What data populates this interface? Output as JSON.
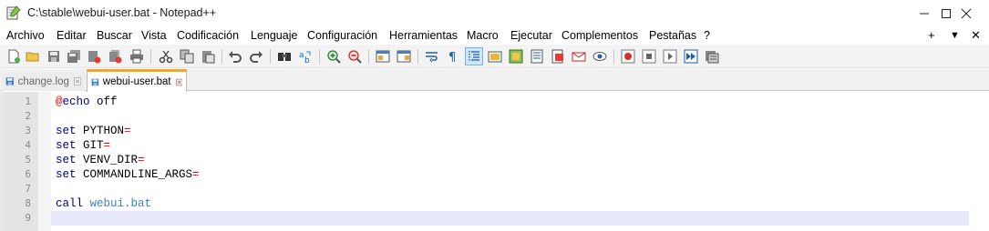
{
  "window": {
    "title": "C:\\stable\\webui-user.bat - Notepad++",
    "minimize_icon": "minimize-icon",
    "maximize_icon": "maximize-icon",
    "close_icon": "close-icon"
  },
  "menu": {
    "items": [
      "Archivo",
      "Editar",
      "Buscar",
      "Vista",
      "Codificación",
      "Lenguaje",
      "Configuración",
      "Herramientas",
      "Macro",
      "Ejecutar",
      "Complementos",
      "Pestañas",
      "?"
    ],
    "right": [
      "+",
      "▼",
      "✕"
    ]
  },
  "toolbar": {
    "icons": [
      "new-file-icon",
      "open-file-icon",
      "save-icon",
      "save-all-icon",
      "close-icon",
      "close-all-icon",
      "print-icon",
      "cut-icon",
      "copy-icon",
      "paste-icon",
      "undo-icon",
      "redo-icon",
      "find-icon",
      "replace-icon",
      "zoom-in-icon",
      "zoom-out-icon",
      "sync-vertical-icon",
      "sync-horizontal-icon",
      "word-wrap-icon",
      "show-all-chars-icon",
      "indent-guide-icon",
      "udl-icon",
      "doc-map-icon",
      "function-list-icon",
      "folder-workspace-icon",
      "doc-list-icon",
      "monitoring-icon",
      "record-macro-icon",
      "stop-recording-icon",
      "playback-macro-icon",
      "run-macro-multiple-icon",
      "save-macro-icon"
    ]
  },
  "tabs": [
    {
      "label": "change.log",
      "active": false
    },
    {
      "label": "webui-user.bat",
      "active": true
    }
  ],
  "editor": {
    "lines": [
      {
        "num": "1",
        "tokens": [
          {
            "t": "@",
            "c": "at"
          },
          {
            "t": "echo",
            "c": "kw-echo"
          },
          {
            "t": " off",
            "c": "txt"
          }
        ]
      },
      {
        "num": "2",
        "tokens": []
      },
      {
        "num": "3",
        "tokens": [
          {
            "t": "set",
            "c": "kw"
          },
          {
            "t": " PYTHON",
            "c": "txt"
          },
          {
            "t": "=",
            "c": "op"
          }
        ]
      },
      {
        "num": "4",
        "tokens": [
          {
            "t": "set",
            "c": "kw"
          },
          {
            "t": " GIT",
            "c": "txt"
          },
          {
            "t": "=",
            "c": "op"
          }
        ]
      },
      {
        "num": "5",
        "tokens": [
          {
            "t": "set",
            "c": "kw"
          },
          {
            "t": " VENV_DIR",
            "c": "txt"
          },
          {
            "t": "=",
            "c": "op"
          }
        ]
      },
      {
        "num": "6",
        "tokens": [
          {
            "t": "set",
            "c": "kw"
          },
          {
            "t": " COMMANDLINE_ARGS",
            "c": "txt"
          },
          {
            "t": "=",
            "c": "op"
          }
        ]
      },
      {
        "num": "7",
        "tokens": []
      },
      {
        "num": "8",
        "tokens": [
          {
            "t": "call",
            "c": "kw"
          },
          {
            "t": " webui.bat",
            "c": "call-tgt"
          }
        ]
      },
      {
        "num": "9",
        "tokens": []
      }
    ],
    "current_line": 9
  },
  "colors": {
    "keyword": "#00007f",
    "operator": "#ff0000",
    "caret_line": "#e8e8ff",
    "active_tab_accent": "#f5a623"
  }
}
